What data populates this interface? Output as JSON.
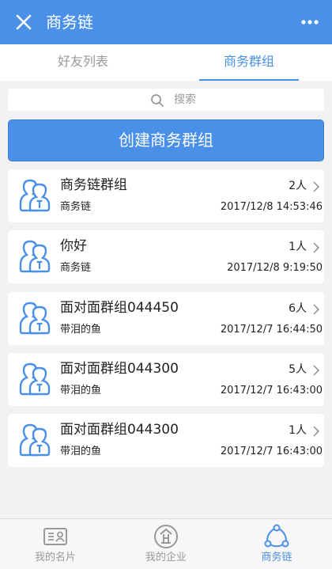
{
  "header": {
    "title": "商务链"
  },
  "tabs": [
    {
      "label": "好友列表"
    },
    {
      "label": "商务群组"
    }
  ],
  "search": {
    "placeholder": "搜索"
  },
  "create_button": {
    "label": "创建商务群组"
  },
  "groups": [
    {
      "name": "商务链群组",
      "count": "2人",
      "owner": "商务链",
      "time": "2017/12/8 14:53:46"
    },
    {
      "name": "你好",
      "count": "1人",
      "owner": "商务链",
      "time": "2017/12/8 9:19:50"
    },
    {
      "name": "面对面群组044450",
      "count": "6人",
      "owner": "带泪的鱼",
      "time": "2017/12/7 16:44:50"
    },
    {
      "name": "面对面群组044300",
      "count": "5人",
      "owner": "带泪的鱼",
      "time": "2017/12/7 16:43:00"
    },
    {
      "name": "面对面群组044300",
      "count": "1人",
      "owner": "带泪的鱼",
      "time": "2017/12/7 16:43:00"
    }
  ],
  "bottom_nav": [
    {
      "label": "我的名片",
      "icon": "card-icon"
    },
    {
      "label": "我的企业",
      "icon": "enterprise-icon"
    },
    {
      "label": "商务链",
      "icon": "share-network-icon"
    }
  ],
  "colors": {
    "accent": "#4a90e9",
    "background": "#f2f2f2",
    "muted": "#999999"
  }
}
